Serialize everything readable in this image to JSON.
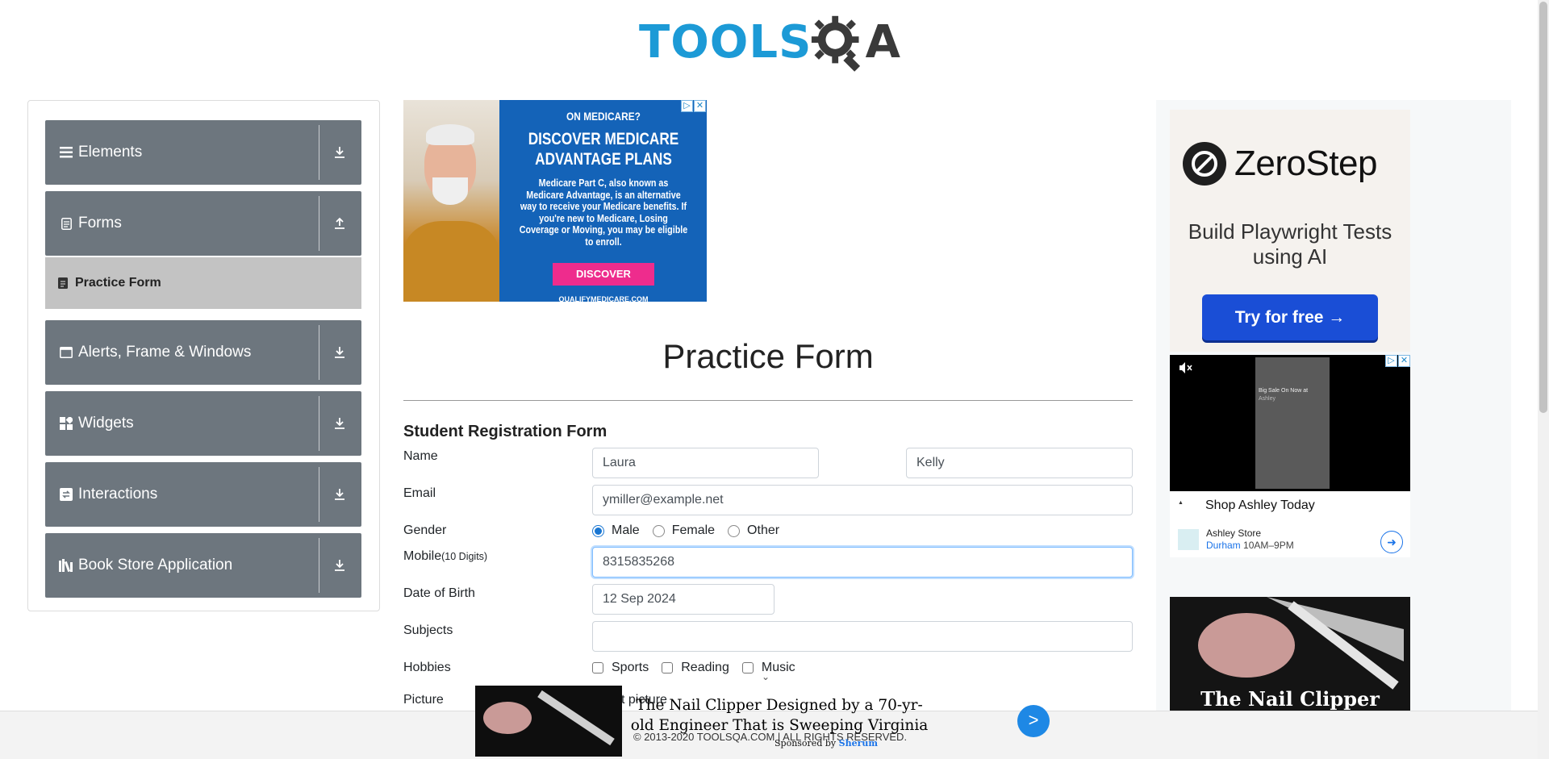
{
  "header": {
    "logo_text": "TOOLS",
    "logo_suffix": "A"
  },
  "sidebar": {
    "groups": [
      {
        "label": "Elements",
        "icon": "menu-icon"
      },
      {
        "label": "Forms",
        "icon": "document-icon"
      },
      {
        "label": "Alerts, Frame & Windows",
        "icon": "window-icon"
      },
      {
        "label": "Widgets",
        "icon": "widgets-icon"
      },
      {
        "label": "Interactions",
        "icon": "interactions-icon"
      },
      {
        "label": "Book Store Application",
        "icon": "books-icon"
      }
    ],
    "active_item": "Practice Form"
  },
  "ad_top": {
    "line1": "ON MEDICARE?",
    "line2": "DISCOVER MEDICARE ADVANTAGE PLANS",
    "body": "Medicare Part C, also known as Medicare Advantage, is an alternative way to receive your Medicare benefits. If you're new to Medicare, Losing Coverage or Moving, you may be eligible to enroll.",
    "button": "DISCOVER",
    "domain": "QUALIFYMEDICARE.COM"
  },
  "main": {
    "title": "Practice Form",
    "form_title": "Student Registration Form",
    "labels": {
      "name": "Name",
      "email": "Email",
      "gender": "Gender",
      "mobile": "Mobile",
      "mobile_hint": "(10 Digits)",
      "dob": "Date of Birth",
      "subjects": "Subjects",
      "hobbies": "Hobbies",
      "picture": "Picture"
    },
    "first_name": "Laura",
    "last_name": "Kelly",
    "email": "ymiller@example.net",
    "gender_options": [
      "Male",
      "Female",
      "Other"
    ],
    "gender_selected": "Male",
    "mobile": "8315835268",
    "dob": "12 Sep 2024",
    "subjects": "",
    "hobbies": [
      "Sports",
      "Reading",
      "Music"
    ],
    "picture_hint": "t picture"
  },
  "right_ads": {
    "zerostep": {
      "name": "ZeroStep",
      "tagline": "Build Playwright Tests using AI",
      "button": "Try for free →"
    },
    "ashley": {
      "video_text": "Big Sale On Now at",
      "video_brand": "Ashley",
      "shop": "Shop Ashley Today",
      "store": "Ashley Store",
      "city": "Durham",
      "hours": "10AM–9PM"
    },
    "nail": {
      "title": "The Nail Clipper"
    }
  },
  "footer": {
    "text": "© 2013-2020 TOOLSQA.COM | ALL RIGHTS RESERVED."
  },
  "bottom_ad": {
    "headline": "The Nail Clipper Designed by a 70-yr-old Engineer That is Sweeping Virginia",
    "sponsored_prefix": "Sponsored by",
    "sponsor": "Sherum",
    "button": ">"
  },
  "colors": {
    "sidebar_group": "#6d767e",
    "active_item": "#c3c3c3",
    "logo_blue": "#1c9ad6",
    "radio": "#1976d2"
  }
}
